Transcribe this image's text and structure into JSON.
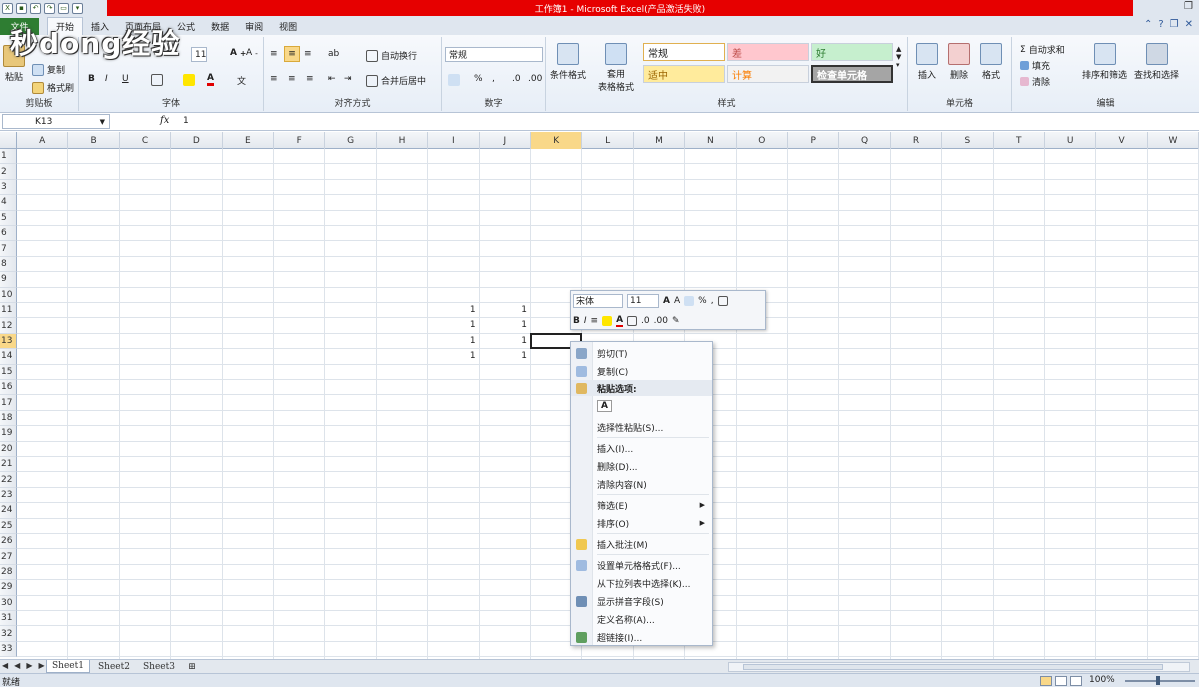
{
  "window": {
    "title": "工作簿1 - Microsoft Excel(产品激活失败)"
  },
  "watermark": "秒dong经验",
  "tabs": [
    {
      "label": "文件"
    },
    {
      "label": "开始"
    },
    {
      "label": "插入"
    },
    {
      "label": "页面布局"
    },
    {
      "label": "公式"
    },
    {
      "label": "数据"
    },
    {
      "label": "审阅"
    },
    {
      "label": "视图"
    }
  ],
  "ribbon": {
    "clipboard": {
      "label": "剪贴板",
      "paste": "粘贴",
      "cut": "剪切",
      "copy": "复制",
      "format_painter": "格式刷"
    },
    "font": {
      "label": "字体",
      "font_name": "宋体",
      "font_size": "11",
      "bold": "B",
      "italic": "I",
      "underline": "U"
    },
    "alignment": {
      "label": "对齐方式",
      "wrap": "自动换行",
      "merge": "合并后居中"
    },
    "number": {
      "label": "数字",
      "format": "常规",
      "percent": "%"
    },
    "styles": {
      "label": "样式",
      "conditional": "条件格式",
      "table_format_1": "套用",
      "table_format_2": "表格格式",
      "cells": [
        {
          "text": "常规",
          "bg": "#ffffff",
          "color": "#222222",
          "border": "#e0b050"
        },
        {
          "text": "差",
          "bg": "#ffc7ce",
          "color": "#c0504d"
        },
        {
          "text": "好",
          "bg": "#c6efce",
          "color": "#2e7d32"
        },
        {
          "text": "适中",
          "bg": "#ffeb9c",
          "color": "#9c6500"
        },
        {
          "text": "计算",
          "bg": "#f2f2f2",
          "color": "#fa7d00"
        },
        {
          "text": "检查单元格",
          "bg": "#a5a5a5",
          "color": "#ffffff"
        }
      ]
    },
    "cells_group": {
      "label": "单元格",
      "insert": "插入",
      "delete": "删除",
      "format": "格式"
    },
    "editing": {
      "label": "编辑",
      "autosum": "自动求和",
      "fill": "填充",
      "clear": "清除",
      "sort": "排序和筛选",
      "find": "查找和选择"
    }
  },
  "formula_bar": {
    "name_box": "K13",
    "fx": "fx",
    "value": "1"
  },
  "columns": [
    "A",
    "B",
    "C",
    "D",
    "E",
    "F",
    "G",
    "H",
    "I",
    "J",
    "K",
    "L",
    "M",
    "N",
    "O",
    "P",
    "Q",
    "R",
    "S",
    "T",
    "U",
    "V",
    "W"
  ],
  "selected_column": "K",
  "rows": [
    "1",
    "2",
    "3",
    "4",
    "5",
    "6",
    "7",
    "8",
    "9",
    "10",
    "11",
    "12",
    "13",
    "14",
    "15",
    "16",
    "17",
    "18",
    "19",
    "20",
    "21",
    "22",
    "23",
    "24",
    "25",
    "26",
    "27",
    "28",
    "29",
    "30",
    "31",
    "32",
    "33"
  ],
  "selected_row": "13",
  "cell_values": [
    {
      "col": "I",
      "row": "11",
      "value": "1"
    },
    {
      "col": "J",
      "row": "11",
      "value": "1"
    },
    {
      "col": "I",
      "row": "12",
      "value": "1"
    },
    {
      "col": "J",
      "row": "12",
      "value": "1"
    },
    {
      "col": "I",
      "row": "13",
      "value": "1"
    },
    {
      "col": "J",
      "row": "13",
      "value": "1"
    },
    {
      "col": "I",
      "row": "14",
      "value": "1"
    },
    {
      "col": "J",
      "row": "14",
      "value": "1"
    }
  ],
  "mini_toolbar": {
    "font_name": "宋体",
    "font_size": "11",
    "percent": "%",
    "comma": ",",
    "bold": "B",
    "italic": "I"
  },
  "context_menu": [
    {
      "label": "剪切(T)",
      "type": "item",
      "icon": "scissors-icon"
    },
    {
      "label": "复制(C)",
      "type": "item",
      "icon": "copy-icon"
    },
    {
      "label": "粘贴选项:",
      "type": "header",
      "icon": "paste-icon"
    },
    {
      "label": "A",
      "type": "paste-option"
    },
    {
      "label": "选择性粘贴(S)...",
      "type": "item"
    },
    {
      "label": "插入(I)...",
      "type": "item"
    },
    {
      "label": "删除(D)...",
      "type": "item"
    },
    {
      "label": "清除内容(N)",
      "type": "item"
    },
    {
      "label": "筛选(E)",
      "type": "submenu"
    },
    {
      "label": "排序(O)",
      "type": "submenu"
    },
    {
      "label": "插入批注(M)",
      "type": "item",
      "icon": "comment-icon"
    },
    {
      "label": "设置单元格格式(F)...",
      "type": "item",
      "icon": "format-cells-icon"
    },
    {
      "label": "从下拉列表中选择(K)...",
      "type": "item"
    },
    {
      "label": "显示拼音字段(S)",
      "type": "item",
      "icon": "phonetic-icon"
    },
    {
      "label": "定义名称(A)...",
      "type": "item"
    },
    {
      "label": "超链接(I)...",
      "type": "item",
      "icon": "hyperlink-icon"
    }
  ],
  "sheets": [
    "Sheet1",
    "Sheet2",
    "Sheet3"
  ],
  "status": {
    "ready": "就绪",
    "zoom": "100%"
  },
  "colors": {
    "accent_red": "#e60000",
    "file_tab": "#2e7d32",
    "selection_header": "#f9d889"
  }
}
